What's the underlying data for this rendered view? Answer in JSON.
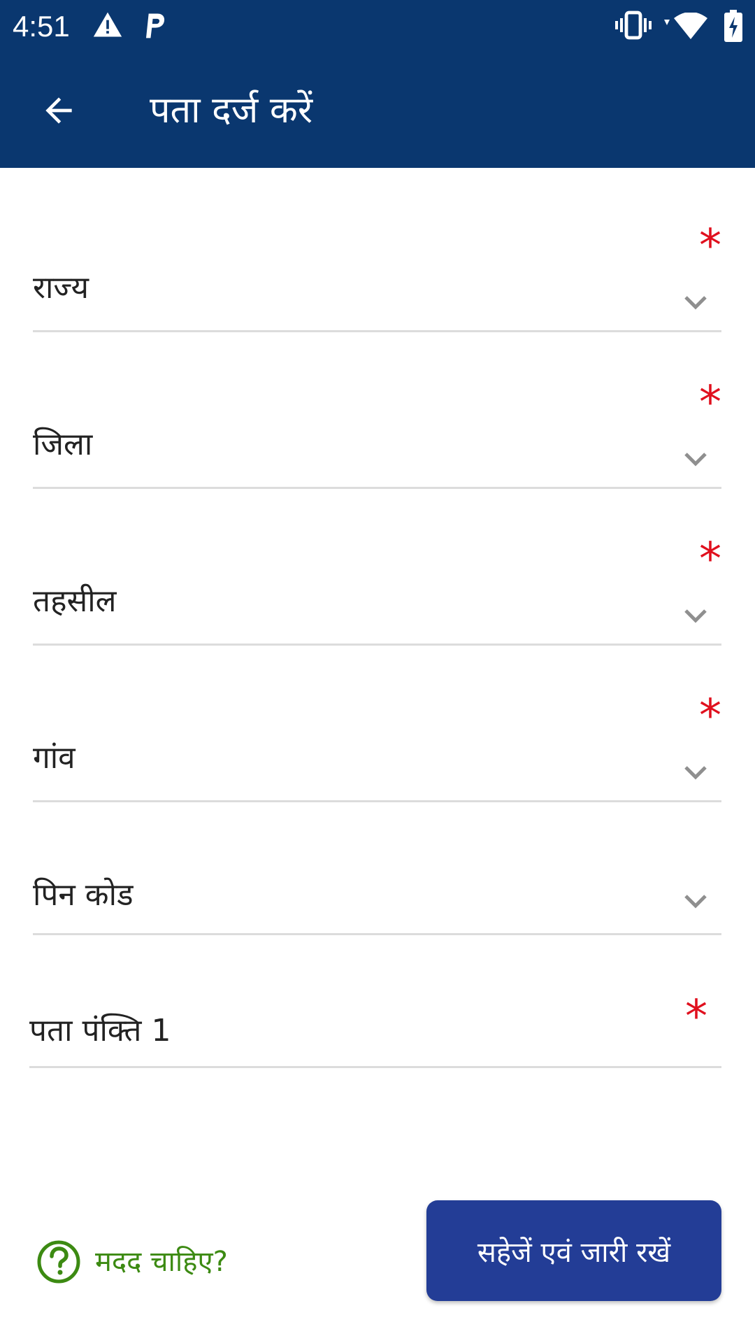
{
  "status_bar": {
    "time": "4:51",
    "left_icons": [
      "alert-icon",
      "parking-icon"
    ],
    "right_icons": [
      "vibrate-icon",
      "wifi-icon",
      "battery-charging-icon"
    ]
  },
  "app_bar": {
    "back_icon": "arrow-back-icon",
    "title": "पता दर्ज करें"
  },
  "form": {
    "state": {
      "label": "राज्य",
      "required": "*"
    },
    "district": {
      "label": "जिला",
      "required": "*"
    },
    "tehsil": {
      "label": "तहसील",
      "required": "*"
    },
    "village": {
      "label": "गांव",
      "required": "*"
    },
    "pincode": {
      "label": "पिन कोड"
    },
    "address_line1": {
      "label": "पता पंक्ति 1",
      "required": "*"
    }
  },
  "help": {
    "icon": "help-circle-icon",
    "label": "मदद चाहिए?"
  },
  "save_button": {
    "label": "सहेजें एवं जारी रखें"
  },
  "colors": {
    "primary": "#0a376f",
    "button": "#233d96",
    "required": "#e0101e",
    "help": "#3c8a12"
  }
}
